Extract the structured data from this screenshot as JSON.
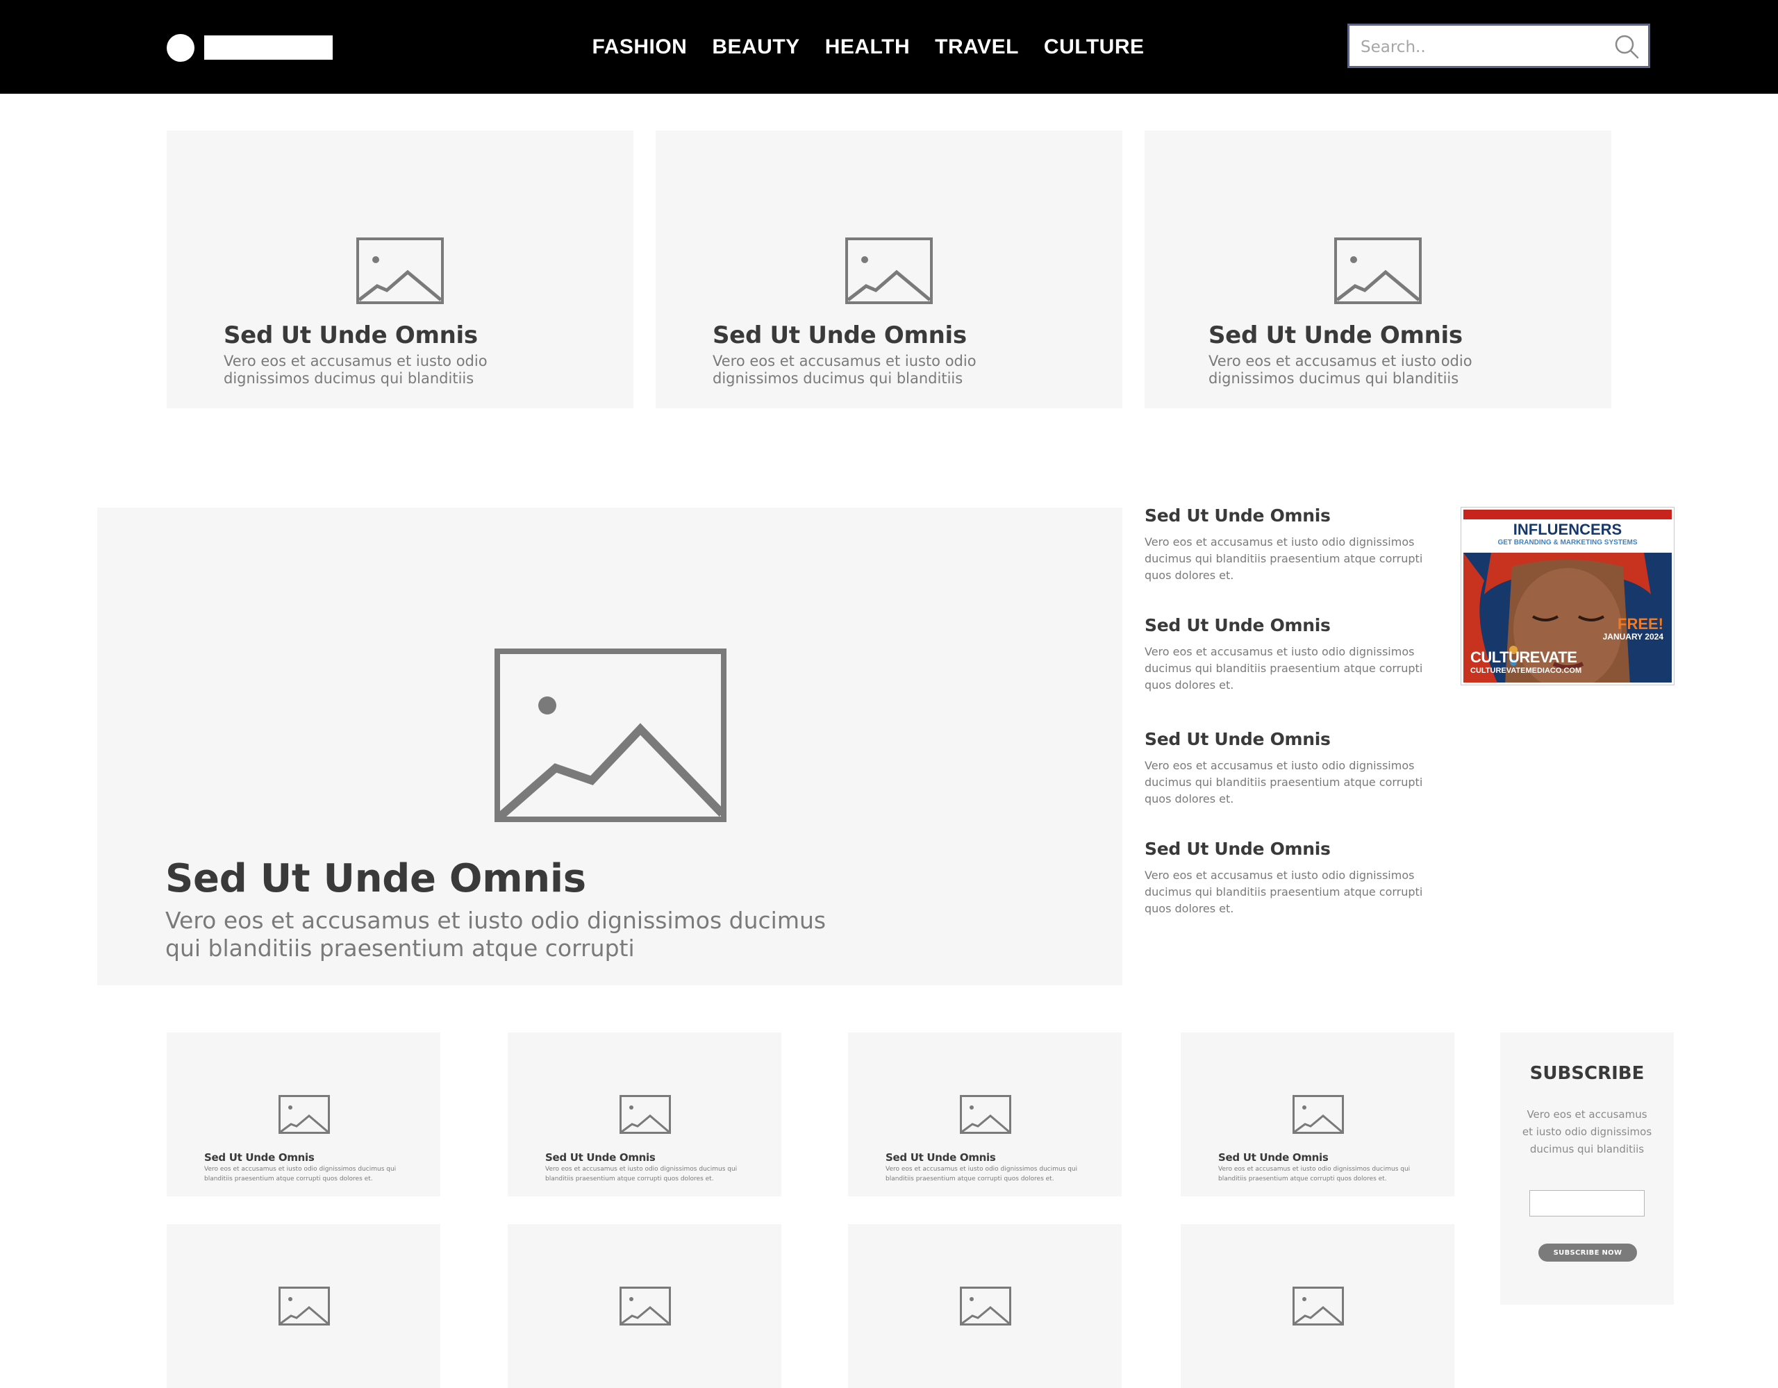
{
  "nav": {
    "items": [
      "FASHION",
      "BEAUTY",
      "HEALTH",
      "TRAVEL",
      "CULTURE"
    ]
  },
  "search": {
    "placeholder": "Search.."
  },
  "top_cards": [
    {
      "title": "Sed Ut Unde Omnis",
      "text": "Vero eos et accusamus et iusto odio dignissimos ducimus qui blanditiis"
    },
    {
      "title": "Sed Ut Unde Omnis",
      "text": "Vero eos et accusamus et iusto odio dignissimos ducimus qui blanditiis"
    },
    {
      "title": "Sed Ut Unde Omnis",
      "text": "Vero eos et accusamus et iusto odio dignissimos ducimus qui blanditiis"
    }
  ],
  "featured": {
    "title": "Sed Ut Unde Omnis",
    "text": "Vero eos et accusamus et iusto odio dignissimos ducimus qui blanditiis praesentium atque corrupti"
  },
  "side_list": [
    {
      "title": "Sed Ut Unde Omnis",
      "text": "Vero eos et accusamus et iusto odio dignissimos ducimus qui blanditiis praesentium atque corrupti quos dolores et."
    },
    {
      "title": "Sed Ut Unde Omnis",
      "text": "Vero eos et accusamus et iusto odio dignissimos ducimus qui blanditiis praesentium atque corrupti quos dolores et."
    },
    {
      "title": "Sed Ut Unde Omnis",
      "text": "Vero eos et accusamus et iusto odio dignissimos ducimus qui blanditiis praesentium atque corrupti quos dolores et."
    },
    {
      "title": "Sed Ut Unde Omnis",
      "text": "Vero eos et accusamus et iusto odio dignissimos ducimus qui blanditiis praesentium atque corrupti quos dolores et."
    }
  ],
  "ad": {
    "headline": "INFLUENCERS",
    "subhead": "GET BRANDING & MARKETING SYSTEMS",
    "free": "FREE!",
    "date": "JANUARY 2024",
    "brand": "CULTUREVATE",
    "url": "CULTUREVATEMEDIACO.COM"
  },
  "small_cards": [
    {
      "title": "Sed Ut Unde Omnis",
      "text": "Vero eos et accusamus et iusto odio dignissimos ducimus qui blanditiis praesentium atque corrupti quos dolores et."
    },
    {
      "title": "Sed Ut Unde Omnis",
      "text": "Vero eos et accusamus et iusto odio dignissimos ducimus qui blanditiis praesentium atque corrupti quos dolores et."
    },
    {
      "title": "Sed Ut Unde Omnis",
      "text": "Vero eos et accusamus et iusto odio dignissimos ducimus qui blanditiis praesentium atque corrupti quos dolores et."
    },
    {
      "title": "Sed Ut Unde Omnis",
      "text": "Vero eos et accusamus et iusto odio dignissimos ducimus qui blanditiis praesentium atque corrupti quos dolores et."
    }
  ],
  "subscribe": {
    "title": "SUBSCRIBE",
    "text": "Vero eos et accusamus et iusto odio dignissimos ducimus qui blanditiis",
    "button": "SUBSCRIBE NOW"
  },
  "icons": {
    "image_placeholder": "image-placeholder-icon",
    "search": "search-icon"
  },
  "colors": {
    "header_bg": "#000000",
    "card_bg": "#f6f6f6",
    "search_border": "#5d6485",
    "placeholder_stroke": "#7a7a7a",
    "button_bg": "#7b7b7b",
    "ad_blue": "#17386b",
    "ad_orange": "#f07b22"
  }
}
